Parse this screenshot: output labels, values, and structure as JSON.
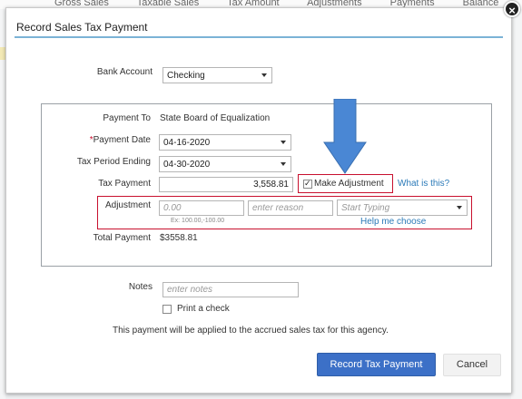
{
  "background": {
    "column_headers": [
      "Gross Sales",
      "Taxable Sales",
      "Tax Amount",
      "Adjustments",
      "Payments",
      "Balance"
    ]
  },
  "dialog": {
    "title": "Record Sales Tax Payment",
    "close_label": "×",
    "accent_color": "#7bb3d6"
  },
  "bank_account": {
    "label": "Bank Account",
    "value": "Checking"
  },
  "payment_to": {
    "label": "Payment To",
    "value": "State Board of Equalization"
  },
  "payment_date": {
    "required_mark": "*",
    "label": "Payment Date",
    "value": "04-16-2020"
  },
  "tax_period_ending": {
    "label": "Tax Period Ending",
    "value": "04-30-2020"
  },
  "tax_payment": {
    "label": "Tax Payment",
    "value": "3,558.81"
  },
  "make_adjustment": {
    "label": "Make Adjustment",
    "checked": true,
    "check_mark": "✓"
  },
  "what_is_this": "What is this?",
  "adjustment": {
    "label": "Adjustment",
    "amount_placeholder": "0.00",
    "reason_placeholder": "enter reason",
    "account_placeholder": "Start Typing",
    "hint": "Ex: 100.00,-100.00",
    "help_link": "Help me choose"
  },
  "total_payment": {
    "label": "Total Payment",
    "value": "$3558.81"
  },
  "notes": {
    "label": "Notes",
    "placeholder": "enter notes"
  },
  "print_check": {
    "label": "Print a check",
    "checked": false
  },
  "info_text": "This payment will be applied to the accrued sales tax for this agency.",
  "buttons": {
    "record": "Record Tax Payment",
    "cancel": "Cancel"
  },
  "colors": {
    "primary_button": "#3c70c7",
    "highlight_box": "#c8102e",
    "arrow": "#4a87d4"
  }
}
